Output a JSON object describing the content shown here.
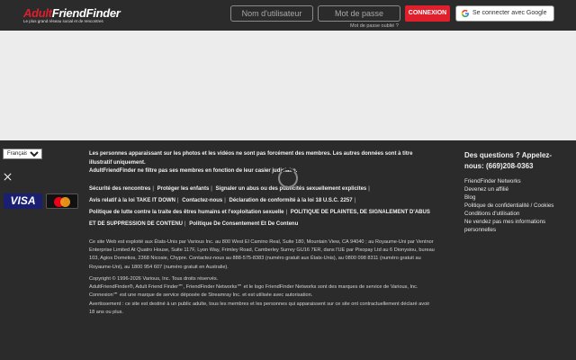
{
  "header": {
    "logo_part1": "Adult",
    "logo_part2": "FriendFinder",
    "logo_tagline": "Le plus grand réseau social et de rencontres",
    "username_placeholder": "Nom d'utilisateur",
    "password_placeholder": "Mot de passe",
    "forgot_password": "Mot de passe oublié ?",
    "login_label": "CONNEXION",
    "google_label": "Se connecter avec Google"
  },
  "footer": {
    "language": "Français",
    "disclaimer": [
      "Les personnes apparaissant sur les photos et les vidéos ne sont pas forcément des membres. Les autres données sont à titre illustratif uniquement.",
      "AdultFriendFinder ne filtre pas ses membres en fonction de leur casier judiciaire."
    ],
    "links": [
      "Sécurité des rencontres",
      "Protéger les enfants",
      "Signaler un abus ou des publicités sexuellement explicites",
      "Avis relatif à la loi TAKE IT DOWN",
      "Contactez-nous",
      "Déclaration de conformité à la loi 18 U.S.C. 2257",
      "Politique de lutte contre la traite des êtres humains et l'exploitation sexuelle",
      "POLITIQUE DE PLAINTES, DE SIGNALEMENT D'ABUS ET DE SUPPRESSION DE CONTENU",
      "Politique De Consentement Et De Contenu"
    ],
    "legal_operator": "Ce site Web est exploité aux États-Unis par Various Inc. au 800 West El Camino Real, Suite 180, Mountain View, CA 94040 ; au Royaume-Uni par Ventnor Enterprise Limited At Quatro House, Suite 117F, Lyon Way, Frimley Road, Camberley Surrey GU16 7ER, dans l'UE par Pixopay Ltd au 6 Dionysiou, bureau 103, Agios Dometios, 2368 Nicosie, Chypre. Contactez-nous au 888-575-8383 (numéro gratuit aux États-Unis), au 0800 098 8311 (numéro gratuit au Royaume-Uni), au 1800 954 607 (numéro gratuit en Australie).",
    "legal_copyright": [
      "Copyright © 1996-2026 Various, Inc. Tous droits réservés.",
      "AdultFriendFinder®, Adult Friend Finder℠, FriendFinder Networks℠ et le logo FriendFinder Networks sont des marques de service de Various, Inc.",
      "Connexion℠ est une marque de service déposée de Streamray Inc. et est utilisée avec autorisation.",
      "Avertissement : ce site est destiné à un public adulte, tous les membres et les personnes qui apparaissent sur ce site ont contractuellement déclaré avoir 18 ans ou plus."
    ],
    "help_title": "Des questions ? Appelez-nous: (669)208-0363",
    "help_links": [
      "FriendFinder Networks",
      "Devenez un affilié",
      "Blog",
      "Politique de confidentialité / Cookies",
      "Conditions d'utilisation",
      "Ne vendez pas mes informations personnelles"
    ],
    "visa_label": "VISA"
  },
  "colors": {
    "header_bg": "#2b2b2b",
    "brand_red": "#e01f2c",
    "content_bg": "#ececec"
  }
}
